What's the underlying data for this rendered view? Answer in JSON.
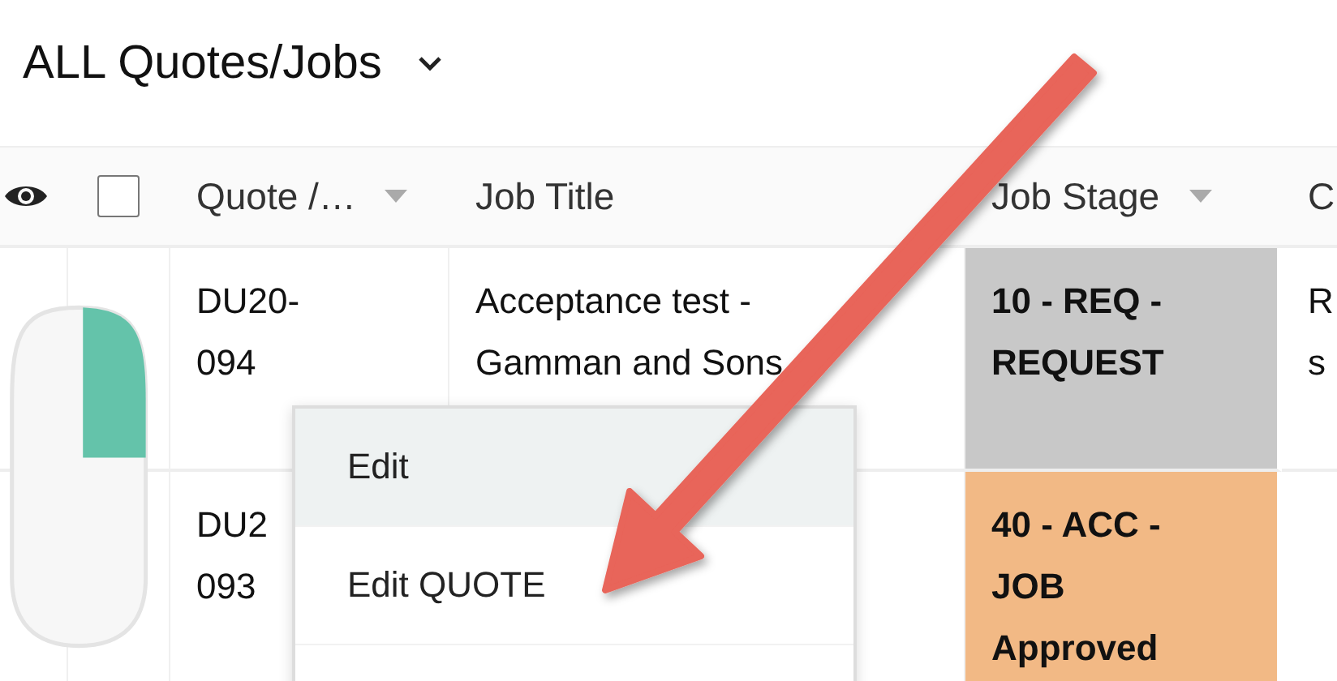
{
  "page": {
    "title": "ALL Quotes/Jobs"
  },
  "table": {
    "select_all": {
      "checked": false
    },
    "columns": [
      {
        "label": "Quote /…",
        "sortable": true
      },
      {
        "label": "Job Title",
        "sortable": false
      },
      {
        "label": "Job Stage",
        "sortable": true
      },
      {
        "label": "C",
        "sortable": false
      }
    ],
    "rows": [
      {
        "quote": "DU20-\n094",
        "job_title": "Acceptance test -\nGamman and Sons",
        "job_stage": "10 - REQ -\nREQUEST",
        "color": "#c8c8c8",
        "column_5": "R\ns"
      },
      {
        "quote": "DU2\n093",
        "job_stage": "40 - ACC -\nJOB\nApproved",
        "color": "#f2b985"
      }
    ]
  },
  "context_menu": {
    "items": [
      {
        "label": "Edit",
        "selected": true
      },
      {
        "label": "Edit QUOTE",
        "selected": false
      }
    ]
  }
}
